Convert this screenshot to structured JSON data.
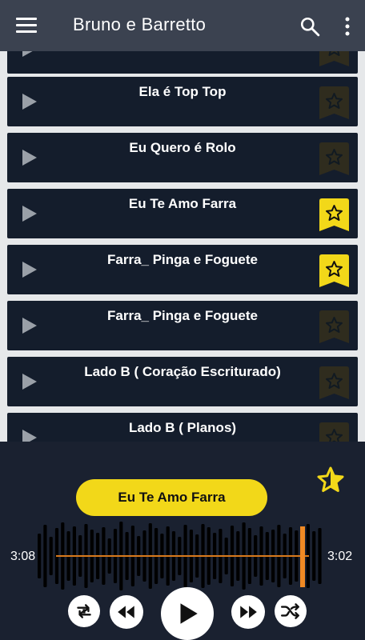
{
  "appbar": {
    "title": "Bruno e Barretto"
  },
  "songs": [
    {
      "name": "",
      "favorite": false
    },
    {
      "name": "Ela é Top Top",
      "favorite": false
    },
    {
      "name": "Eu Quero é Rolo",
      "favorite": false
    },
    {
      "name": "Eu Te Amo Farra",
      "favorite": true
    },
    {
      "name": "Farra_ Pinga e Foguete",
      "favorite": true
    },
    {
      "name": "Farra_ Pinga e Foguete",
      "favorite": false
    },
    {
      "name": "Lado B ( Coração Escriturado)",
      "favorite": false
    },
    {
      "name": "Lado B ( Planos)",
      "favorite": false
    }
  ],
  "player": {
    "now_playing": "Eu Te Amo Farra",
    "elapsed": "3:08",
    "remaining": "3:02",
    "progress": 0.93
  },
  "colors": {
    "appbar": "#3b4250",
    "accent_yellow": "#f2d819",
    "progress_orange": "#f08a24",
    "row_bg": "#141d2c"
  },
  "icons": {
    "menu": "hamburger-icon",
    "search": "search-icon",
    "more": "more-vertical-icon",
    "favorite": "star-bookmark-icon",
    "repeat": "repeat-one-icon",
    "previous": "rewind-icon",
    "play": "play-icon",
    "next": "fast-forward-icon",
    "shuffle": "shuffle-icon"
  }
}
